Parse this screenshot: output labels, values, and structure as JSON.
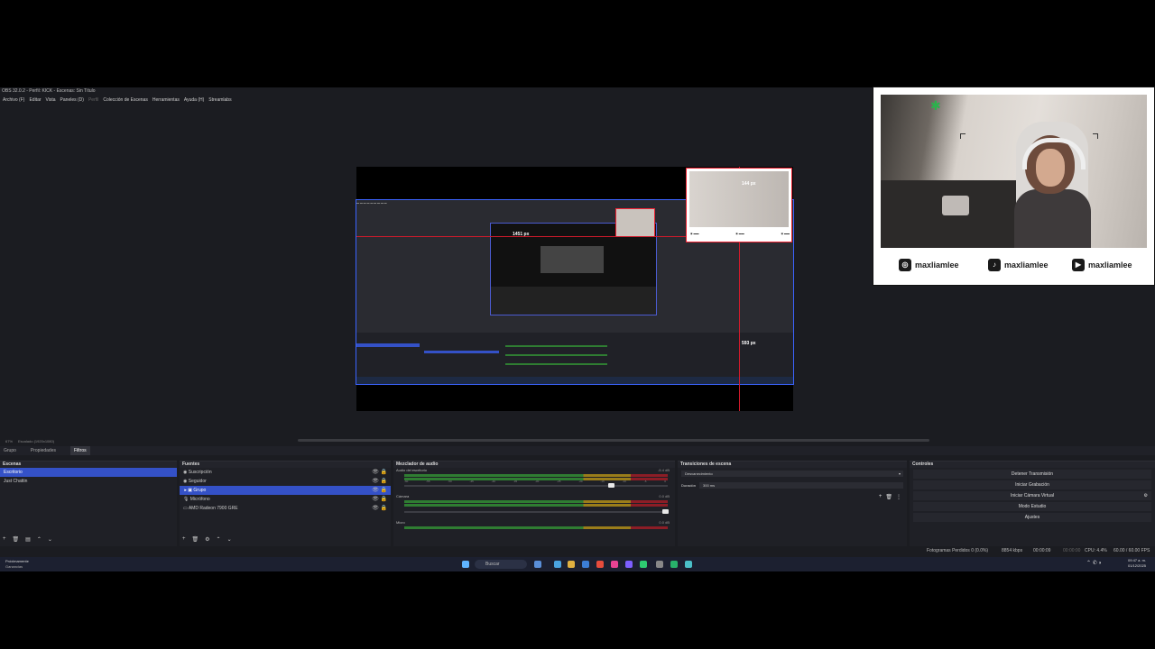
{
  "window": {
    "title": "OBS 32.0.2 - Perfil: KICK - Escenas: Sin Título"
  },
  "menu": [
    "Archivo (F)",
    "Editar",
    "Vista",
    "Paneles (D)",
    "Perfil",
    "Colección de Escenas",
    "Herramientas",
    "Ayuda (H)",
    "Streamlabs"
  ],
  "preview": {
    "label_top": "144 px",
    "label_mid": "1451 px",
    "label_bottom": "593 px"
  },
  "statusline": {
    "zoom": "67%",
    "scale": "Escalado (1920x1080)"
  },
  "contextbar": {
    "source": "Grupo",
    "properties": "Propiedades",
    "filters": "Filtros"
  },
  "docks": {
    "scenes": {
      "title": "Escenas",
      "items": [
        "Escritorio",
        "Just Chattin"
      ]
    },
    "sources": {
      "title": "Fuentes",
      "items": [
        "Suscripción",
        "Seguidor",
        "Grupo",
        "Micrófono",
        "AMD Radeon 7900 GRE"
      ]
    },
    "mixer": {
      "title": "Mezclador de audio",
      "channels": [
        {
          "name": "Audio del escritorio",
          "db": "-5.4 dB"
        },
        {
          "name": "Cámara",
          "db": "0.0 dB"
        },
        {
          "name": "Micro",
          "db": "0.0 dB"
        }
      ],
      "ticks": [
        "-60",
        "-55",
        "-50",
        "-45",
        "-40",
        "-35",
        "-30",
        "-25",
        "-20",
        "-15",
        "-10",
        "-5",
        "0"
      ]
    },
    "transitions": {
      "title": "Transiciones de escena",
      "type": "Desvanecimiento",
      "duration_label": "Duración",
      "duration": "300 ms"
    },
    "controls": {
      "title": "Controles",
      "buttons": [
        "Detener Transmisión",
        "Iniciar Grabación",
        "Iniciar Cámara Virtual",
        "Modo Estudio",
        "Ajustes"
      ]
    }
  },
  "stats": {
    "dropped": "Fotogramas Perdidos 0 (0.0%)",
    "bitrate": "8854 kbps",
    "live": "00:00:09",
    "rec": "00:00:00",
    "cpu": "CPU: 4.4%",
    "fps": "60.00 / 60.00 FPS"
  },
  "taskbar": {
    "weather_title": "Próximamente",
    "weather_sub": "Ganancias",
    "search": "Buscar",
    "time": "09:47 a. m.",
    "date": "01/12/2025"
  },
  "webcam": {
    "handles": [
      "maxliamlee",
      "maxliamlee",
      "maxliamlee"
    ],
    "icons": [
      "instagram-icon",
      "tiktok-icon",
      "youtube-icon"
    ]
  }
}
